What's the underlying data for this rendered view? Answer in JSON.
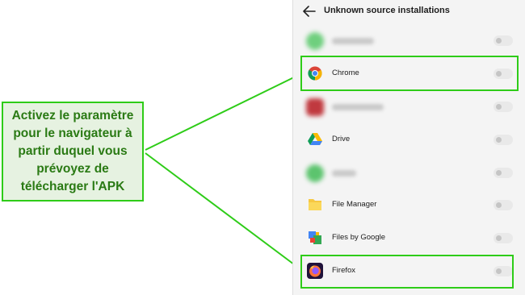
{
  "callout": {
    "text": "Activez le paramètre pour le navigateur à partir duquel vous prévoyez de télécharger l'APK"
  },
  "screen": {
    "title": "Unknown source installations",
    "back_icon": "arrow-left-icon"
  },
  "apps": [
    {
      "label": "",
      "icon": "blurred-app-icon",
      "enabled": false,
      "highlighted": false
    },
    {
      "label": "Chrome",
      "icon": "chrome-icon",
      "enabled": false,
      "highlighted": true
    },
    {
      "label": "",
      "icon": "blurred-app-icon",
      "enabled": false,
      "highlighted": false
    },
    {
      "label": "Drive",
      "icon": "google-drive-icon",
      "enabled": false,
      "highlighted": false
    },
    {
      "label": "",
      "icon": "blurred-app-icon",
      "enabled": false,
      "highlighted": false
    },
    {
      "label": "File Manager",
      "icon": "folder-icon",
      "enabled": false,
      "highlighted": false
    },
    {
      "label": "Files by Google",
      "icon": "files-by-google-icon",
      "enabled": false,
      "highlighted": false
    },
    {
      "label": "Firefox",
      "icon": "firefox-icon",
      "enabled": false,
      "highlighted": true
    }
  ],
  "colors": {
    "highlight": "#2ecc18",
    "callout_bg": "#e6f2e1",
    "callout_text": "#2a7a14"
  }
}
